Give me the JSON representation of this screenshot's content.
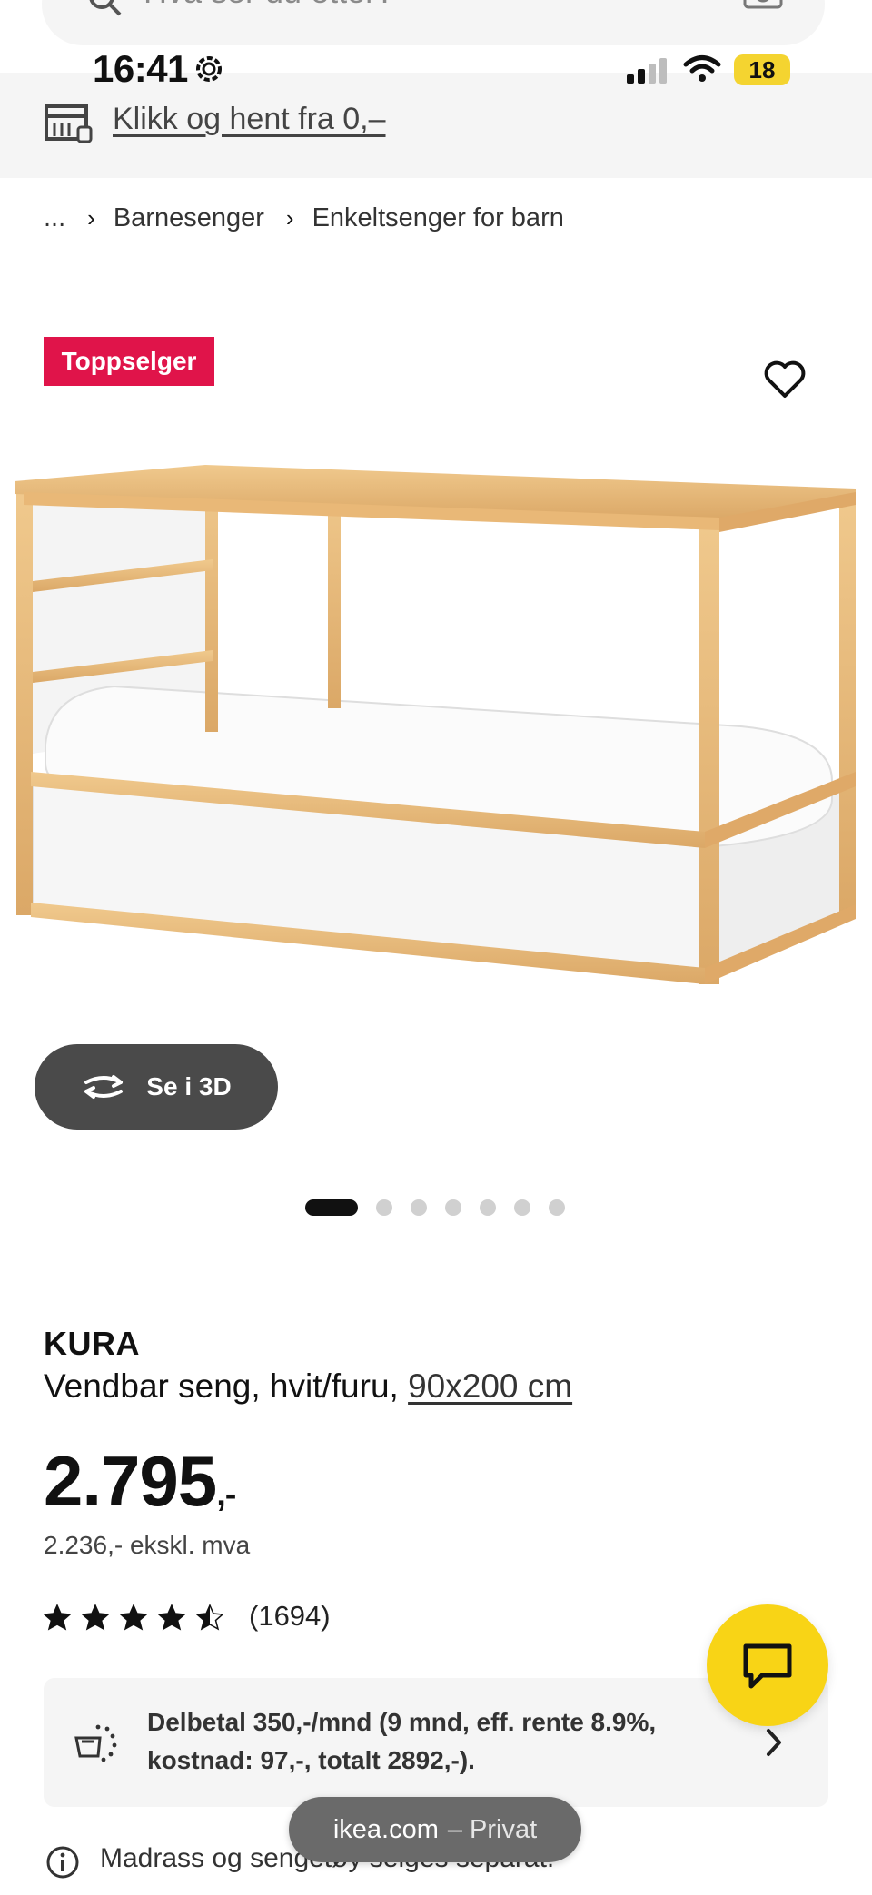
{
  "search": {
    "placeholder": "Hva ser du etter?"
  },
  "status_bar": {
    "time": "16:41",
    "battery": "18"
  },
  "pickup": {
    "label": "Klikk og hent fra 0,–"
  },
  "breadcrumb": {
    "ellipsis": "...",
    "items": [
      "Barnesenger",
      "Enkeltsenger for barn"
    ]
  },
  "badge": {
    "label": "Toppselger"
  },
  "view_3d": {
    "label": "Se i 3D"
  },
  "carousel": {
    "total": 7,
    "active_index": 0
  },
  "product": {
    "name": "KURA",
    "description": "Vendbar seng, hvit/furu,",
    "size": "90x200 cm",
    "price_main": "2.795",
    "price_suffix": ",-",
    "price_ex_vat": "2.236,- ekskl. mva",
    "rating": 4.5,
    "rating_count": "(1694)"
  },
  "finance": {
    "text": "Delbetal 350,-/mnd (9 mnd, eff. rente 8.9%, kostnad: 97,-, totalt 2892,-)."
  },
  "notice": {
    "text": "Madrass og sengetøy selges separat."
  },
  "browser": {
    "domain": "ikea.com",
    "mode": "– Privat"
  },
  "colors": {
    "badge": "#e0144a",
    "chat_fab": "#f8d416",
    "battery": "#f4d430",
    "pill": "#6a6a6a"
  },
  "icons": {
    "pickup": "store-pickup-icon",
    "favorite": "heart-icon",
    "rotate_3d": "rotate-3d-icon",
    "chat": "chat-icon",
    "finance": "payment-icon",
    "notice": "info-icon"
  }
}
